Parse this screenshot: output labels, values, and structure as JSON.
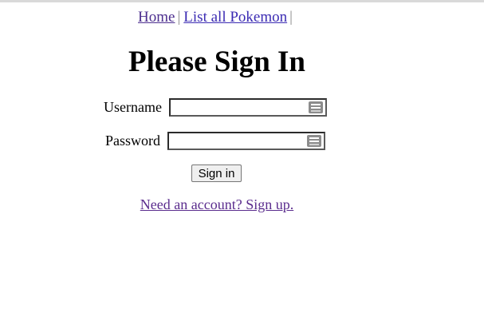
{
  "nav": {
    "home_label": "Home",
    "separator": "|",
    "list_label": "List all Pokemon",
    "trailing_separator": "|"
  },
  "form": {
    "title": "Please Sign In",
    "username_label": "Username",
    "username_value": "",
    "password_label": "Password",
    "password_value": "",
    "submit_label": "Sign in",
    "signup_link": "Need an account? Sign up."
  },
  "colors": {
    "link": "#3b2bb3",
    "visited_link": "#5b2d8e",
    "separator": "#8a8a8a",
    "button_bg": "#efefef"
  },
  "icons": {
    "field_icon": "password-manager-icon"
  }
}
